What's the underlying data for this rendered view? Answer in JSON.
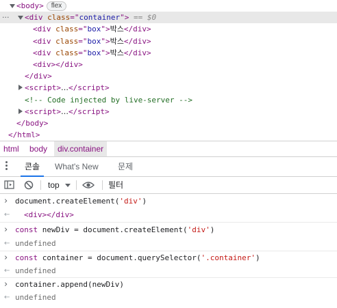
{
  "elements": {
    "lines": [
      {
        "indent": 0,
        "toggle": "down",
        "kind": "open",
        "tag": "body",
        "badge": "flex"
      },
      {
        "indent": 1,
        "toggle": "down",
        "kind": "open",
        "tag": "div",
        "attr": "class",
        "value": "container",
        "selected": true,
        "suffix": "== $0"
      },
      {
        "indent": 2,
        "kind": "full",
        "tag": "div",
        "attr": "class",
        "value": "box",
        "text": "박스"
      },
      {
        "indent": 2,
        "kind": "full",
        "tag": "div",
        "attr": "class",
        "value": "box",
        "text": "박스"
      },
      {
        "indent": 2,
        "kind": "full",
        "tag": "div",
        "attr": "class",
        "value": "box",
        "text": "박스"
      },
      {
        "indent": 2,
        "kind": "full",
        "tag": "div",
        "text": ""
      },
      {
        "indent": 1,
        "kind": "close",
        "tag": "div"
      },
      {
        "indent": 1,
        "toggle": "right",
        "kind": "collapsed",
        "tag": "script"
      },
      {
        "indent": 1,
        "kind": "comment",
        "text": "<!-- Code injected by live-server -->"
      },
      {
        "indent": 1,
        "toggle": "right",
        "kind": "collapsed",
        "tag": "script"
      },
      {
        "indent": 0,
        "kind": "close",
        "tag": "body"
      },
      {
        "indent": -1,
        "kind": "close",
        "tag": "html"
      }
    ]
  },
  "breadcrumbs": [
    "html",
    "body",
    "div.container"
  ],
  "drawer": {
    "tabs": [
      {
        "label": "콘솔",
        "active": true
      },
      {
        "label": "What's New",
        "active": false
      },
      {
        "label": "문제",
        "active": false
      }
    ]
  },
  "toolbar": {
    "context": "top",
    "filter_placeholder": "필터"
  },
  "console": {
    "entries": [
      {
        "type": "input",
        "parts": [
          [
            "plain",
            "document.createElement("
          ],
          [
            "str",
            "'div'"
          ],
          [
            "plain",
            ")"
          ]
        ]
      },
      {
        "type": "output",
        "parts": [
          [
            "tag",
            "<div></div>"
          ]
        ]
      },
      {
        "type": "input",
        "parts": [
          [
            "kw",
            "const"
          ],
          [
            "plain",
            " newDiv = document.createElement("
          ],
          [
            "str",
            "'div'"
          ],
          [
            "plain",
            ")"
          ]
        ]
      },
      {
        "type": "output",
        "parts": [
          [
            "undef",
            "undefined"
          ]
        ]
      },
      {
        "type": "input",
        "parts": [
          [
            "kw",
            "const"
          ],
          [
            "plain",
            " container = document.querySelector("
          ],
          [
            "str",
            "'.container'"
          ],
          [
            "plain",
            ")"
          ]
        ]
      },
      {
        "type": "output",
        "parts": [
          [
            "undef",
            "undefined"
          ]
        ]
      },
      {
        "type": "input",
        "parts": [
          [
            "plain",
            "container.append(newDiv)"
          ]
        ]
      },
      {
        "type": "output",
        "parts": [
          [
            "undef",
            "undefined"
          ]
        ]
      }
    ]
  },
  "colors": {
    "tag": "#881280",
    "attr_name": "#994500",
    "attr_value": "#1a1aa6",
    "comment": "#236e25",
    "string": "#c41a16",
    "active_tab_underline": "#1a73e8",
    "selected_row": "#e8e8e8"
  },
  "icons": [
    "expand-triangle-icon",
    "collapse-triangle-icon",
    "more-dots-icon",
    "drawer-menu-icon",
    "sidebar-toggle-icon",
    "clear-console-icon",
    "dropdown-arrow-icon",
    "eye-icon",
    "prompt-chevron-icon",
    "return-arrow-icon"
  ]
}
